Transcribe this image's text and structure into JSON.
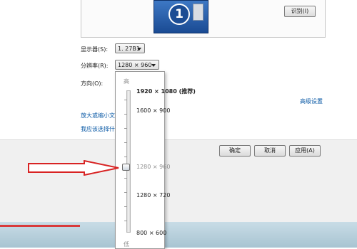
{
  "monitor": {
    "number": "1"
  },
  "buttons": {
    "identify": "识别(I)",
    "ok": "确定",
    "cancel": "取消",
    "apply": "应用(A)"
  },
  "fields": {
    "display_label": "显示器(S):",
    "display_value": "1. 27B1",
    "resolution_label": "分辨率(R):",
    "resolution_value": "1280 × 960",
    "orientation_label": "方向(O):"
  },
  "links": {
    "advanced": "高级设置",
    "enlarge": "放大或缩小文本",
    "which": "我应该选择什么"
  },
  "dropdown": {
    "high": "高",
    "low": "低",
    "options": [
      "1920 × 1080 (推荐)",
      "1600 × 900",
      "1280 × 960",
      "1280 × 720",
      "800 × 600"
    ],
    "selected": "1280 × 960"
  },
  "colors": {
    "accent": "#0b5aa6",
    "arrow": "#d82323"
  },
  "icons": {
    "monitor": "monitor-icon",
    "arrow": "red-arrow-icon"
  }
}
